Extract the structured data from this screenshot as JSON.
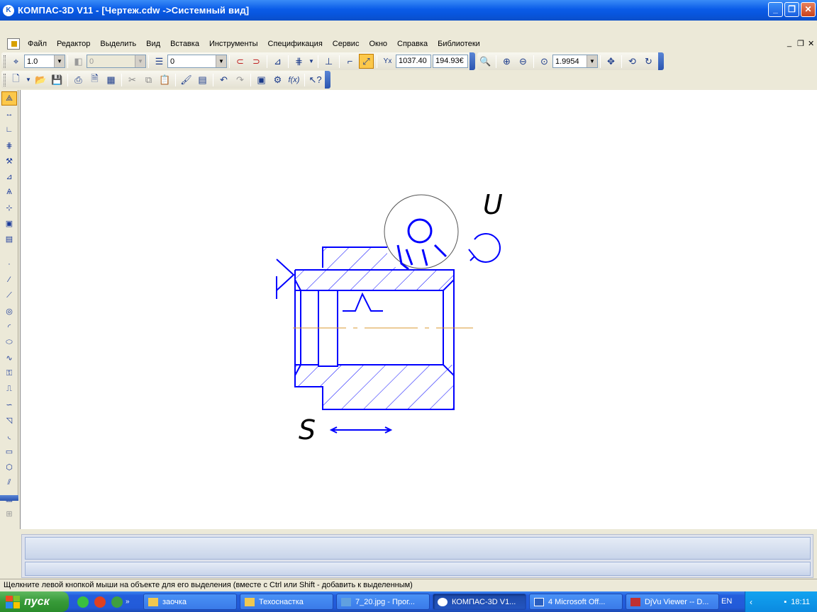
{
  "window": {
    "title": "КОМПАС-3D V11 - [Чертеж.cdw ->Системный вид]",
    "controls": {
      "minimize": "_",
      "maximize": "❐",
      "close": "✕"
    }
  },
  "menu": {
    "items": [
      "Файл",
      "Редактор",
      "Выделить",
      "Вид",
      "Вставка",
      "Инструменты",
      "Спецификация",
      "Сервис",
      "Окно",
      "Справка",
      "Библиотеки"
    ],
    "doc_controls": [
      "_",
      "❐",
      "✕"
    ]
  },
  "toolbar_current": {
    "step_value": "1.0",
    "layer_disabled_value": "0",
    "layer_value": "0",
    "coord_x": "1037.40",
    "coord_y": "194.93€",
    "zoom_value": "1.9954"
  },
  "drawing": {
    "label_u": "U",
    "label_s": "S"
  },
  "status": {
    "hint": "Щелкните левой кнопкой мыши на объекте для его выделения (вместе с Ctrl или Shift - добавить к выделенным)"
  },
  "taskbar": {
    "start_label": "пуск",
    "tasks": [
      {
        "label": "заочка",
        "icon": "folder-icon"
      },
      {
        "label": "Техоснастка",
        "icon": "folder-icon"
      },
      {
        "label": "7_20.jpg - Прог...",
        "icon": "image-icon"
      },
      {
        "label": "КОМПАС-3D V1...",
        "icon": "kompas-icon"
      },
      {
        "label": "4 Microsoft Off...",
        "icon": "word-icon"
      },
      {
        "label": "DjVu Viewer -- D...",
        "icon": "djvu-icon"
      }
    ],
    "language": "EN",
    "clock": "18:11"
  },
  "colors": {
    "drawing_line": "#0000ff",
    "axis_line": "#d89a30",
    "active_tool": "#fcc84a",
    "xp_blue": "#0a5ce8"
  }
}
